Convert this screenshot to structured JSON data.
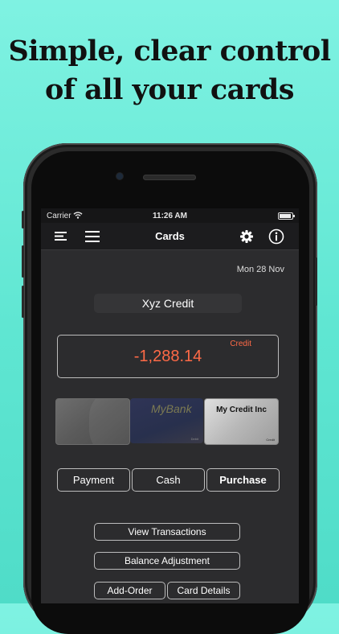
{
  "headline": {
    "line1": "Simple, clear control",
    "line2": "of all your cards"
  },
  "status_bar": {
    "carrier": "Carrier",
    "time": "11:26 AM"
  },
  "nav": {
    "title": "Cards",
    "left_icons": [
      "sort-lines-icon",
      "menu-icon"
    ],
    "right_icons": [
      "gear-icon",
      "info-icon"
    ]
  },
  "date": "Mon 28 Nov",
  "selected_card": {
    "name": "Xyz Credit",
    "type_label": "Credit",
    "balance": "-1,288.14"
  },
  "cards": [
    {
      "name": ""
    },
    {
      "name": "MyBank",
      "type": "Debit"
    },
    {
      "name": "My Credit Inc",
      "type": "Credit"
    }
  ],
  "segments": [
    "Payment",
    "Cash",
    "Purchase"
  ],
  "actions": {
    "view_transactions": "View Transactions",
    "balance_adjustment": "Balance Adjustment",
    "add_order": "Add-Order",
    "card_details": "Card Details"
  },
  "colors": {
    "background": "#5fe6d2",
    "negative_amount": "#ff6a47",
    "screen": "#2c2c2e"
  }
}
